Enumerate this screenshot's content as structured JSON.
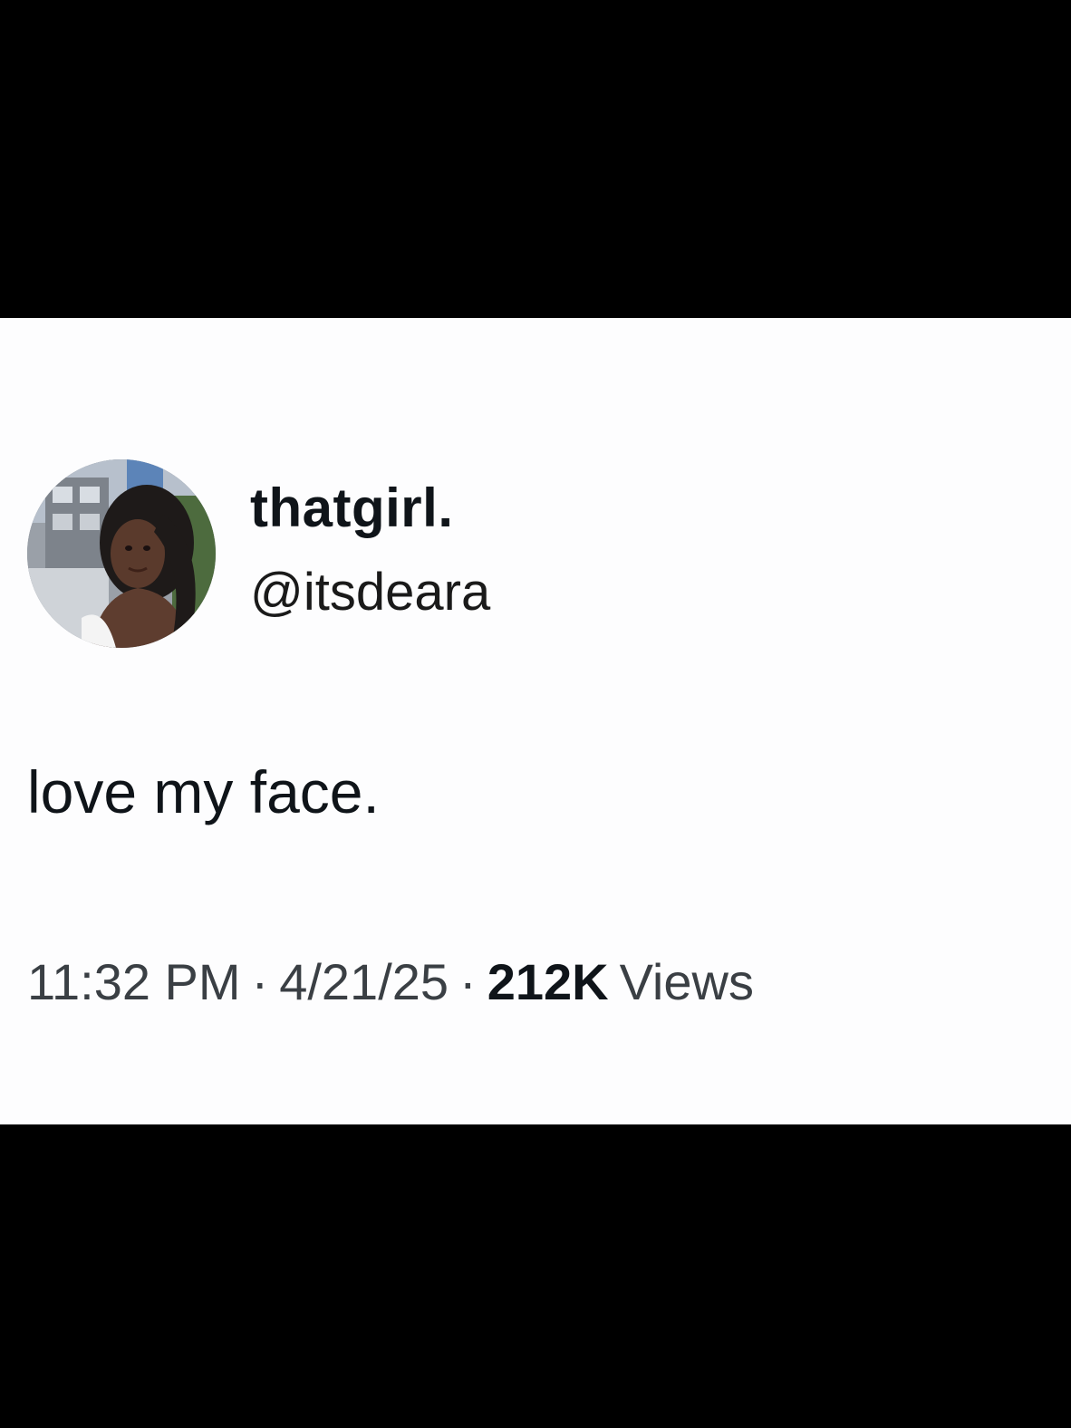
{
  "tweet": {
    "author": {
      "display_name": "thatgirl.",
      "handle": "@itsdeara"
    },
    "text": "love my face.",
    "meta": {
      "time": "11:32 PM",
      "separator": "·",
      "date": "4/21/25",
      "views_count": "212K",
      "views_label": "Views"
    }
  },
  "colors": {
    "letterbox": "#000000",
    "card_background": "#fdfdfe",
    "primary_text": "#0f1419",
    "secondary_text": "#3a3f44"
  }
}
